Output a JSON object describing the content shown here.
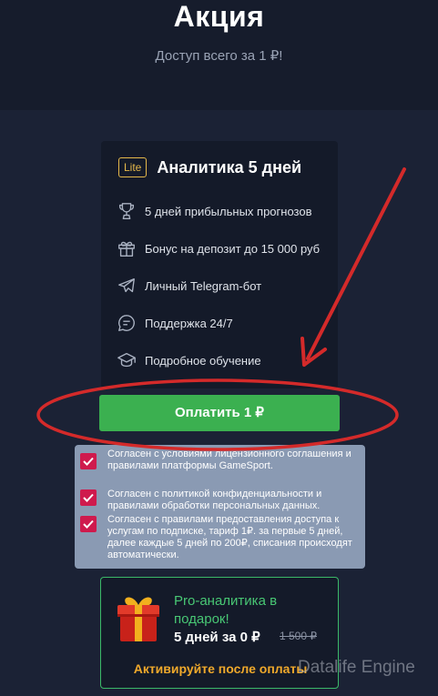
{
  "hero": {
    "title": "Акция",
    "subtitle": "Доступ всего за 1 ₽!"
  },
  "plan": {
    "badge": "Lite",
    "title": "Аналитика 5 дней",
    "features": [
      {
        "icon": "trophy-icon",
        "label": "5 дней прибыльных прогнозов"
      },
      {
        "icon": "gift-icon",
        "label": "Бонус на депозит до 15 000 руб"
      },
      {
        "icon": "telegram-icon",
        "label": "Личный Telegram-бот"
      },
      {
        "icon": "chat-icon",
        "label": "Поддержка 24/7"
      },
      {
        "icon": "graduation-cap-icon",
        "label": "Подробное обучение"
      }
    ]
  },
  "pay_button": {
    "label": "Оплатить 1 ₽"
  },
  "consents": [
    {
      "checked": true,
      "text": "Согласен с условиями лицензионного соглашения и правилами платформы GameSport."
    },
    {
      "checked": true,
      "text": "Согласен с политикой конфиденциальности и правилами обработки персональных данных."
    },
    {
      "checked": true,
      "text": "Согласен с правилами предоставления доступа к услугам по подписке, тариф 1₽. за первые 5 дней, далее каждые 5 дней по 200₽, списания происходят автоматически."
    }
  ],
  "promo": {
    "title": "Pro-аналитика в подарок!",
    "price": "5 дней за 0 ₽",
    "old_price": "1 500 ₽",
    "activate": "Активируйте после оплаты"
  },
  "watermark": "Datalife Engine",
  "colors": {
    "background": "#1b2235",
    "card": "#141a29",
    "accent_green": "#3bb050",
    "badge_gold": "#e5b84a",
    "checkbox": "#cf1a4d",
    "annotation_red": "#d42a2a",
    "promo_orange": "#f0a92b"
  }
}
